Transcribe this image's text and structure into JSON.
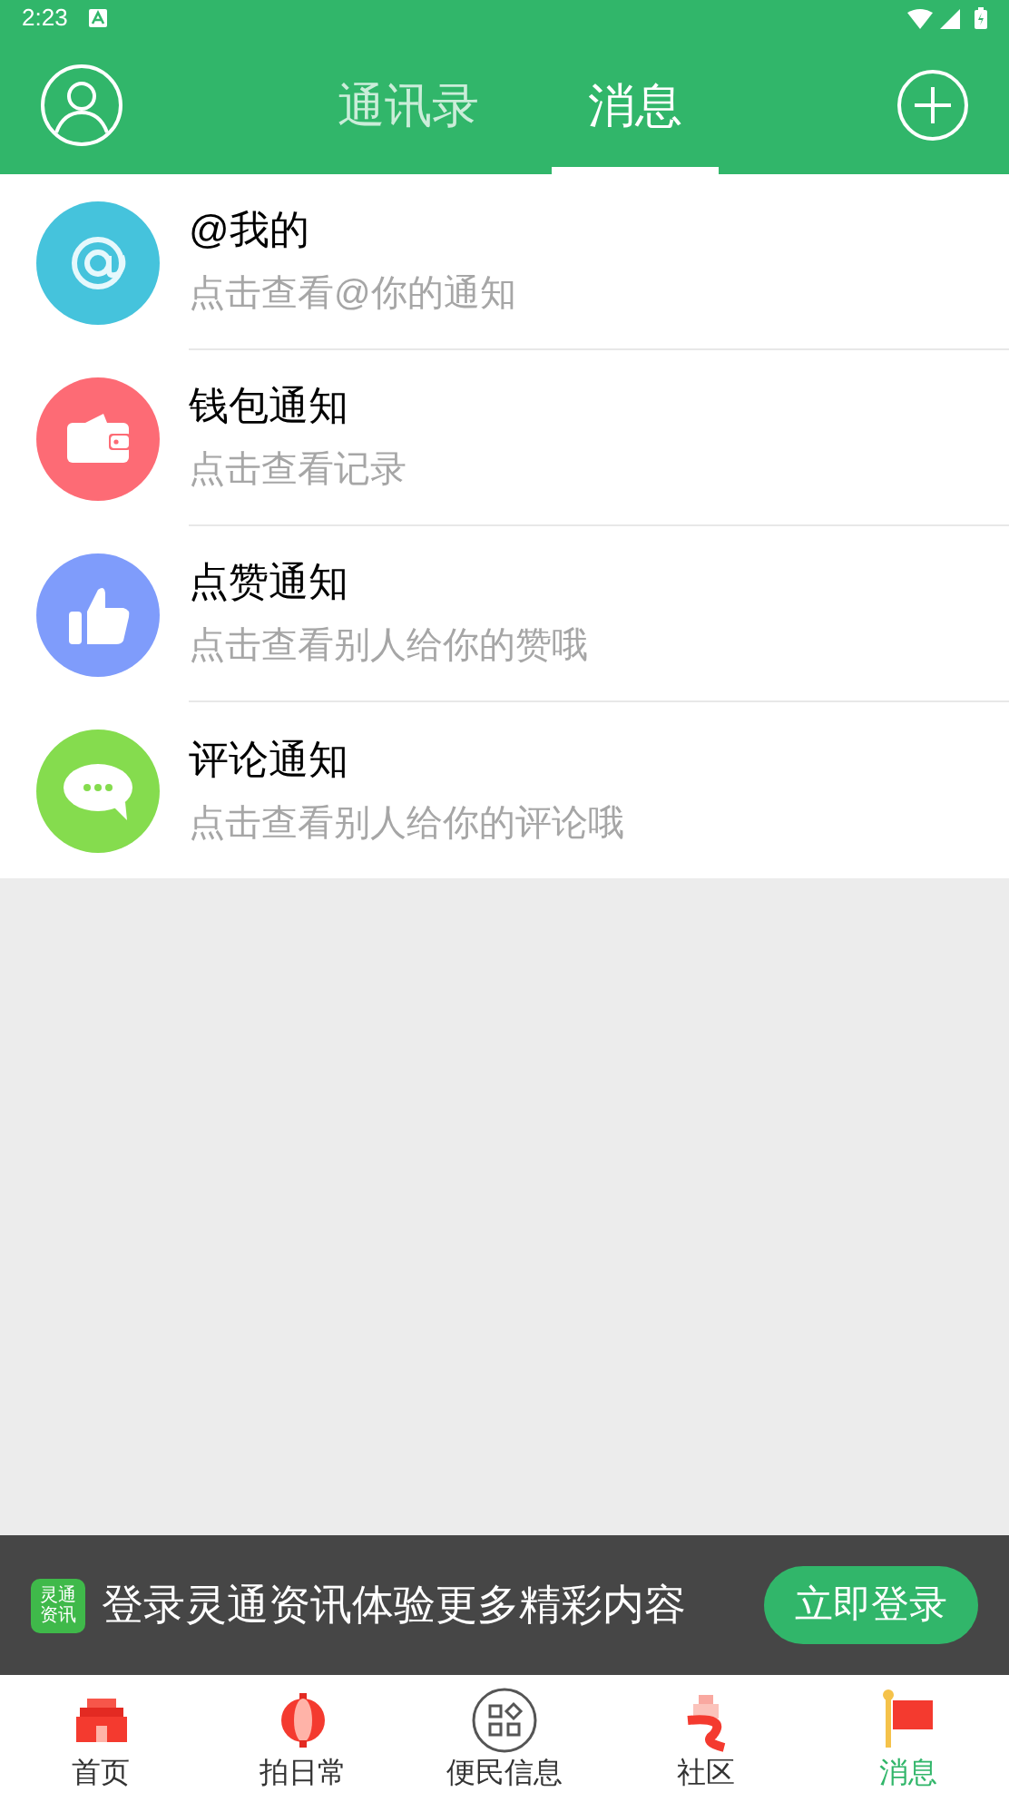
{
  "status_bar": {
    "time": "2:23"
  },
  "header": {
    "tabs": [
      {
        "label": "通讯录",
        "selected": false
      },
      {
        "label": "消息",
        "selected": true
      }
    ]
  },
  "notifications": [
    {
      "kind": "at",
      "color": "#45c3dc",
      "title": "@我的",
      "subtitle": "点击查看@你的通知"
    },
    {
      "kind": "wallet",
      "color": "#fd6b75",
      "title": "钱包通知",
      "subtitle": "点击查看记录"
    },
    {
      "kind": "like",
      "color": "#7f9cfb",
      "title": "点赞通知",
      "subtitle": "点击查看别人给你的赞哦"
    },
    {
      "kind": "comment",
      "color": "#85dc4e",
      "title": "评论通知",
      "subtitle": "点击查看别人给你的评论哦"
    }
  ],
  "login_banner": {
    "logo_text": "灵通资讯",
    "text": "登录灵通资讯体验更多精彩内容",
    "button": "立即登录"
  },
  "bottom_nav": [
    {
      "kind": "home",
      "label": "首页",
      "selected": false
    },
    {
      "kind": "lantern",
      "label": "拍日常",
      "selected": false
    },
    {
      "kind": "grid",
      "label": "便民信息",
      "selected": false
    },
    {
      "kind": "community",
      "label": "社区",
      "selected": false
    },
    {
      "kind": "flag",
      "label": "消息",
      "selected": true
    }
  ]
}
